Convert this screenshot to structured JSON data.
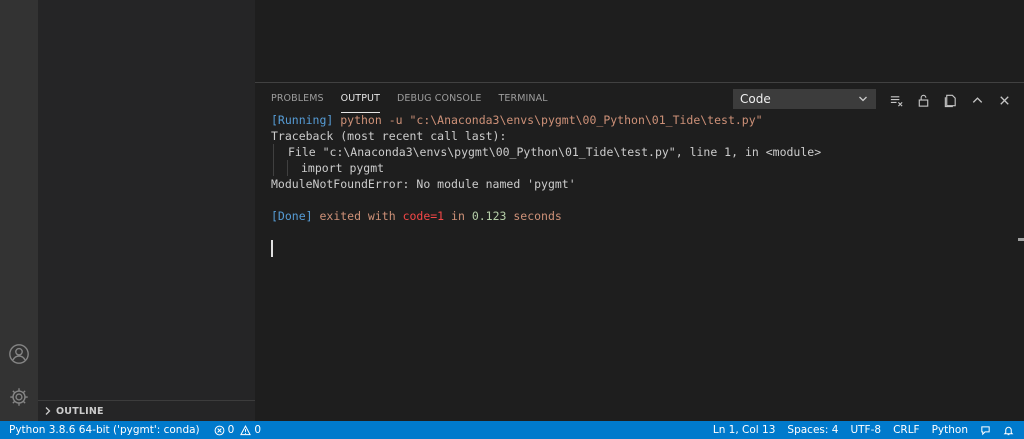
{
  "sidebar": {
    "outline_label": "OUTLINE"
  },
  "panel": {
    "tabs": [
      "PROBLEMS",
      "OUTPUT",
      "DEBUG CONSOLE",
      "TERMINAL"
    ],
    "active_tab": "OUTPUT",
    "channel": "Code"
  },
  "output": {
    "running_tag": "[Running]",
    "running_cmd": " python -u \"c:\\Anaconda3\\envs\\pygmt\\00_Python\\01_Tide\\test.py\"",
    "traceback": "Traceback (most recent call last):",
    "file_line": "File \"c:\\Anaconda3\\envs\\pygmt\\00_Python\\01_Tide\\test.py\", line 1, in <module>",
    "import_line": "import pygmt",
    "error_line": "ModuleNotFoundError: No module named 'pygmt'",
    "done_tag": "[Done]",
    "done_text": " exited with ",
    "done_code": "code=1",
    "done_in": " in ",
    "done_time": "0.123",
    "done_unit": " seconds"
  },
  "status": {
    "interpreter": "Python 3.8.6 64-bit ('pygmt': conda)",
    "errors": "0",
    "warnings": "0",
    "position": "Ln 1, Col 13",
    "spaces": "Spaces: 4",
    "encoding": "UTF-8",
    "eol": "CRLF",
    "language": "Python"
  },
  "icons": {
    "accounts": "account-icon",
    "manage": "gear-icon",
    "outline_chevron": "chevron-right-icon",
    "channel_dropdown": "chevron-down-icon",
    "clear_output": "clear-all-icon",
    "lock_scroll": "lock-icon",
    "open_editor": "open-in-editor-icon",
    "maximize": "chevron-up-icon",
    "close": "close-icon",
    "feedback": "feedback-icon",
    "notifications": "bell-icon"
  },
  "colors": {
    "status_bar": "#007acc",
    "activity_bar": "#333333",
    "sidebar": "#252526",
    "editor": "#1e1e1e"
  }
}
